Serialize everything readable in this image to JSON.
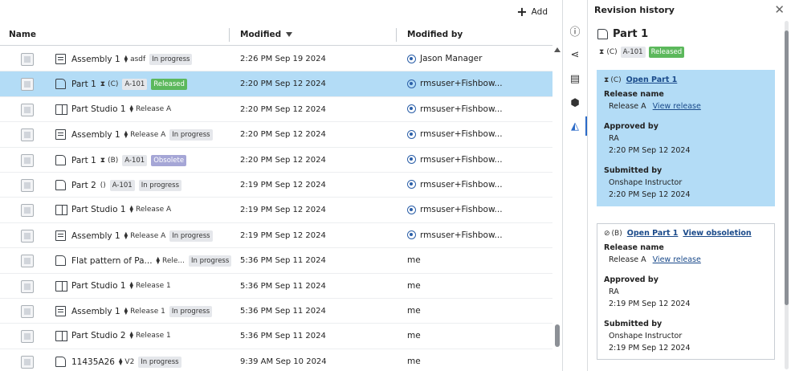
{
  "toolbar_top": {
    "add_label": "Add"
  },
  "columns": {
    "name": "Name",
    "modified": "Modified",
    "modified_by": "Modified by"
  },
  "rows": [
    {
      "type": "assembly",
      "name": "Assembly 1",
      "rev_icon": "⧫",
      "rev": "asdf",
      "part_no": "",
      "state": "In progress",
      "state_style": "grey",
      "modified": "2:26 PM Sep 19 2024",
      "by": "Jason Manager",
      "by_avatar": true,
      "selected": false
    },
    {
      "type": "part",
      "name": "Part 1",
      "rev_icon": "⧗",
      "rev": "(C)",
      "part_no": "A-101",
      "state": "Released",
      "state_style": "green",
      "modified": "2:20 PM Sep 12 2024",
      "by": "rmsuser+Fishbow...",
      "by_avatar": true,
      "selected": true
    },
    {
      "type": "studio",
      "name": "Part Studio 1",
      "rev_icon": "⧫",
      "rev": "Release A",
      "part_no": "",
      "state": "",
      "state_style": "",
      "modified": "2:20 PM Sep 12 2024",
      "by": "rmsuser+Fishbow...",
      "by_avatar": true,
      "selected": false
    },
    {
      "type": "assembly",
      "name": "Assembly 1",
      "rev_icon": "⧫",
      "rev": "Release A",
      "part_no": "",
      "state": "In progress",
      "state_style": "grey",
      "modified": "2:20 PM Sep 12 2024",
      "by": "rmsuser+Fishbow...",
      "by_avatar": true,
      "selected": false
    },
    {
      "type": "part",
      "name": "Part 1",
      "rev_icon": "⧗",
      "rev": "(B)",
      "part_no": "A-101",
      "state": "Obsolete",
      "state_style": "purple",
      "modified": "2:20 PM Sep 12 2024",
      "by": "rmsuser+Fishbow...",
      "by_avatar": true,
      "selected": false
    },
    {
      "type": "part",
      "name": "Part 2",
      "rev_icon": "",
      "rev": "()",
      "part_no": "A-101",
      "state": "In progress",
      "state_style": "grey",
      "modified": "2:19 PM Sep 12 2024",
      "by": "rmsuser+Fishbow...",
      "by_avatar": true,
      "selected": false
    },
    {
      "type": "studio",
      "name": "Part Studio 1",
      "rev_icon": "⧫",
      "rev": "Release A",
      "part_no": "",
      "state": "",
      "state_style": "",
      "modified": "2:19 PM Sep 12 2024",
      "by": "rmsuser+Fishbow...",
      "by_avatar": true,
      "selected": false
    },
    {
      "type": "assembly",
      "name": "Assembly 1",
      "rev_icon": "⧫",
      "rev": "Release A",
      "part_no": "",
      "state": "In progress",
      "state_style": "grey",
      "modified": "2:19 PM Sep 12 2024",
      "by": "rmsuser+Fishbow...",
      "by_avatar": true,
      "selected": false
    },
    {
      "type": "part",
      "name": "Flat pattern of Pa...",
      "rev_icon": "⧫",
      "rev": "Rele...",
      "part_no": "",
      "state": "In progress",
      "state_style": "grey",
      "modified": "5:36 PM Sep 11 2024",
      "by": "me",
      "by_avatar": false,
      "selected": false
    },
    {
      "type": "studio",
      "name": "Part Studio 1",
      "rev_icon": "⧫",
      "rev": "Release 1",
      "part_no": "",
      "state": "",
      "state_style": "",
      "modified": "5:36 PM Sep 11 2024",
      "by": "me",
      "by_avatar": false,
      "selected": false
    },
    {
      "type": "assembly",
      "name": "Assembly 1",
      "rev_icon": "⧫",
      "rev": "Release 1",
      "part_no": "",
      "state": "In progress",
      "state_style": "grey",
      "modified": "5:36 PM Sep 11 2024",
      "by": "me",
      "by_avatar": false,
      "selected": false
    },
    {
      "type": "studio",
      "name": "Part Studio 2",
      "rev_icon": "⧫",
      "rev": "Release 1",
      "part_no": "",
      "state": "",
      "state_style": "",
      "modified": "5:36 PM Sep 11 2024",
      "by": "me",
      "by_avatar": false,
      "selected": false
    },
    {
      "type": "part",
      "name": "11435A26",
      "rev_icon": "⧫",
      "rev": "V2",
      "part_no": "",
      "state": "In progress",
      "state_style": "grey",
      "modified": "9:39 AM Sep 10 2024",
      "by": "me",
      "by_avatar": false,
      "selected": false
    }
  ],
  "side_toolbar": [
    {
      "name": "info-icon",
      "glyph": "ⓘ",
      "active": false
    },
    {
      "name": "share-icon",
      "glyph": "⋖",
      "active": false
    },
    {
      "name": "document-icon",
      "glyph": "▤",
      "active": false
    },
    {
      "name": "apps-icon",
      "glyph": "⬢",
      "active": false
    },
    {
      "name": "revision-history-icon",
      "glyph": "◭",
      "active": true
    }
  ],
  "panel": {
    "title": "Revision history",
    "close_glyph": "✕",
    "item_name": "Part 1",
    "rev_icon": "⧗",
    "rev": "(C)",
    "part_no": "A-101",
    "state": "Released",
    "cards": [
      {
        "highlight": true,
        "rev_icon": "⧗",
        "rev": "(C)",
        "open_link": "Open Part 1",
        "extra_link": "",
        "release_name_label": "Release name",
        "release_name": "Release A",
        "view_release": "View release",
        "approved_label": "Approved by",
        "approved_by": "RA",
        "approved_time": "2:20 PM Sep 12 2024",
        "submitted_label": "Submitted by",
        "submitted_by": "Onshape Instructor",
        "submitted_time": "2:20 PM Sep 12 2024"
      },
      {
        "highlight": false,
        "rev_icon": "⊘",
        "rev": "(B)",
        "open_link": "Open Part 1",
        "extra_link": "View obsoletion",
        "release_name_label": "Release name",
        "release_name": "Release A",
        "view_release": "View release",
        "approved_label": "Approved by",
        "approved_by": "RA",
        "approved_time": "2:19 PM Sep 12 2024",
        "submitted_label": "Submitted by",
        "submitted_by": "Onshape Instructor",
        "submitted_time": "2:19 PM Sep 12 2024"
      }
    ]
  }
}
